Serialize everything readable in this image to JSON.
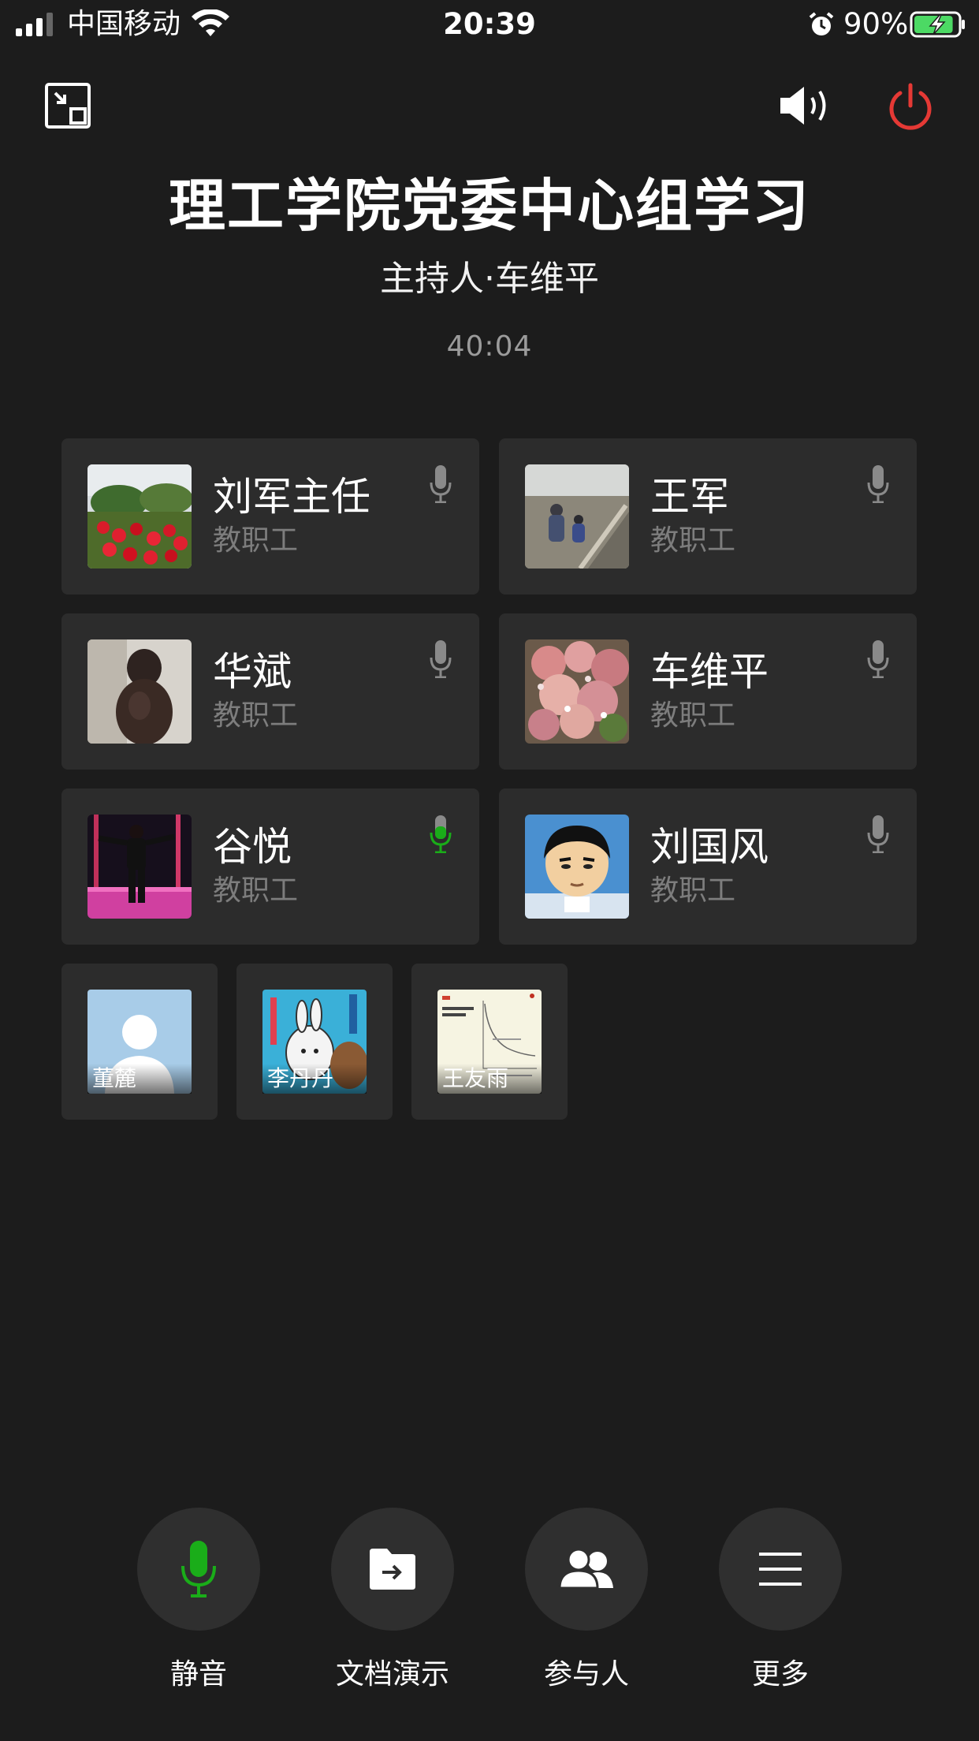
{
  "status_bar": {
    "carrier": "中国移动",
    "time": "20:39",
    "battery_percent": "90%",
    "battery_level": 0.9,
    "icons": [
      "signal-icon",
      "wifi-icon",
      "alarm-icon",
      "battery-charging-icon"
    ]
  },
  "header": {
    "minimize_icon": "minimize-window-icon",
    "speaker_icon": "speaker-icon",
    "hangup_icon": "power-icon",
    "hangup_color": "#e53935"
  },
  "meeting": {
    "title": "理工学院党委中心组学习",
    "host": "主持人·车维平",
    "timer": "40:04"
  },
  "participants": [
    {
      "name": "刘军主任",
      "role": "教职工",
      "speaking": false
    },
    {
      "name": "王军",
      "role": "教职工",
      "speaking": false
    },
    {
      "name": "华斌",
      "role": "教职工",
      "speaking": false
    },
    {
      "name": "车维平",
      "role": "教职工",
      "speaking": false
    },
    {
      "name": "谷悦",
      "role": "教职工",
      "speaking": true
    },
    {
      "name": "刘国风",
      "role": "教职工",
      "speaking": false
    }
  ],
  "other_participants": [
    {
      "name": "董麓"
    },
    {
      "name": "李丹丹"
    },
    {
      "name": "王友雨"
    }
  ],
  "toolbar": {
    "mute_label": "静音",
    "share_label": "文档演示",
    "participants_label": "参与人",
    "more_label": "更多"
  },
  "colors": {
    "background": "#1c1c1c",
    "card": "#2c2c2c",
    "active_mic": "#1aad19",
    "inactive_mic": "#8a8a8a",
    "hangup": "#e53935"
  }
}
